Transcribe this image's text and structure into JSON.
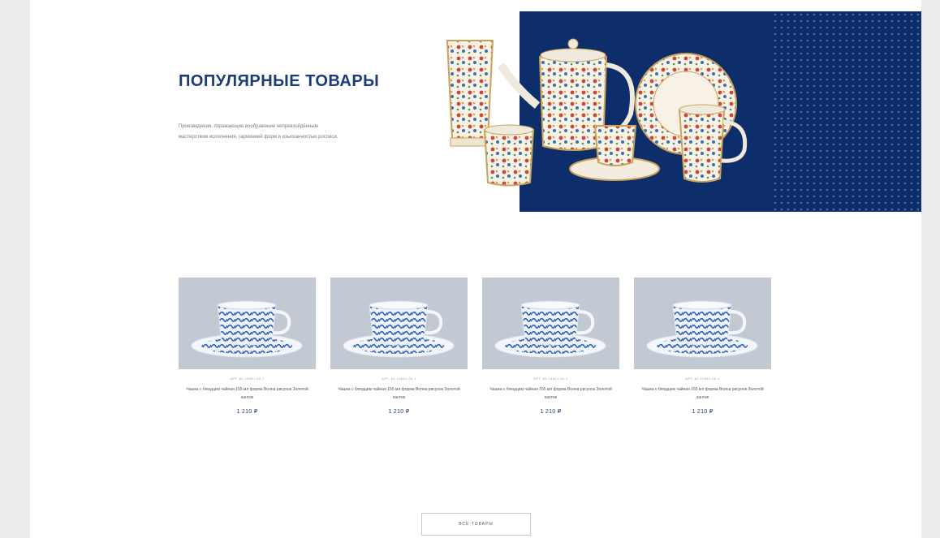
{
  "hero": {
    "title": "ПОПУЛЯРНЫЕ ТОВАРЫ",
    "description": "Произведения, поражающие воображение непревзойдённым мастерством исполнения, гармонией форм и изысканностью росписи.",
    "colors": {
      "brand_blue": "#0e2d6b",
      "title_blue": "#1d3b78"
    },
    "image": "porcelain-tea-set-image"
  },
  "products": [
    {
      "sku": "АРТ. 81.15661.00.1",
      "title": "Чашка с блюдцем чайная 155 мл форма Волна рисунок Золотой кантик",
      "price": "1 210 ₽",
      "image": "blue-cup-saucer-image"
    },
    {
      "sku": "АРТ. 81.15661.00.1",
      "title": "Чашка с блюдцем чайная 155 мл форма Волна рисунок Золотой кантик",
      "price": "1 210 ₽",
      "image": "blue-cup-saucer-image"
    },
    {
      "sku": "АРТ. 81.15661.00.1",
      "title": "Чашка с блюдцем чайная 155 мл форма Волна рисунок Золотой кантик",
      "price": "1 210 ₽",
      "image": "blue-cup-saucer-image"
    },
    {
      "sku": "АРТ. 81.15661.00.1",
      "title": "Чашка с блюдцем чайная 155 мл форма Волна рисунок Золотой кантик",
      "price": "1 210 ₽",
      "image": "blue-cup-saucer-image"
    }
  ],
  "actions": {
    "all_products_label": "ВСЕ ТОВАРЫ"
  }
}
